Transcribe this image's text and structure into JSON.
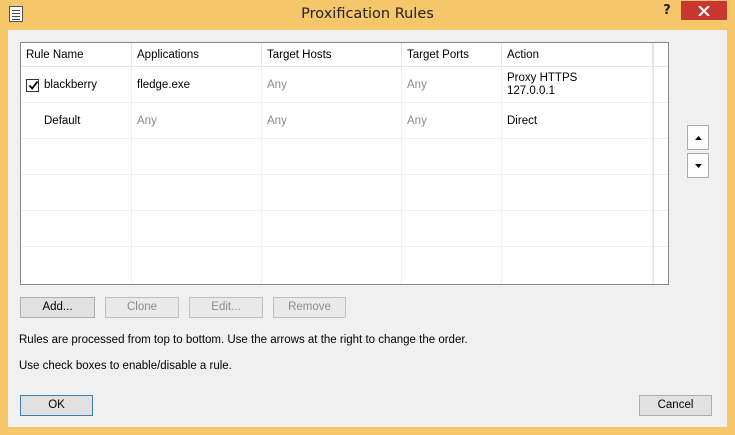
{
  "window": {
    "title": "Proxification Rules",
    "help": "?"
  },
  "table": {
    "columns": [
      "Rule Name",
      "Applications",
      "Target Hosts",
      "Target Ports",
      "Action"
    ],
    "rows": [
      {
        "checked": true,
        "name": "blackberry",
        "applications": "fledge.exe",
        "target_hosts": "Any",
        "target_ports": "Any",
        "action_line1": "Proxy HTTPS",
        "action_line2": "127.0.0.1"
      },
      {
        "checked": false,
        "name": "Default",
        "applications": "Any",
        "target_hosts": "Any",
        "target_ports": "Any",
        "action_line1": "Direct",
        "action_line2": ""
      }
    ]
  },
  "buttons": {
    "add": "Add...",
    "clone": "Clone",
    "edit": "Edit...",
    "remove": "Remove",
    "ok": "OK",
    "cancel": "Cancel"
  },
  "info": {
    "line1": "Rules are processed from top to bottom. Use the arrows at the right to change the order.",
    "line2": "Use check boxes to enable/disable a rule."
  },
  "icons": {
    "app": "rules-list-icon",
    "close": "close-icon",
    "move_up": "arrow-up-icon",
    "move_down": "arrow-down-icon",
    "checkbox": "checkmark-icon"
  },
  "colors": {
    "titlebar": "#f5c66a",
    "close": "#c7372f",
    "dialog": "#f0f0f0",
    "muted_text": "#8a8a8a"
  }
}
